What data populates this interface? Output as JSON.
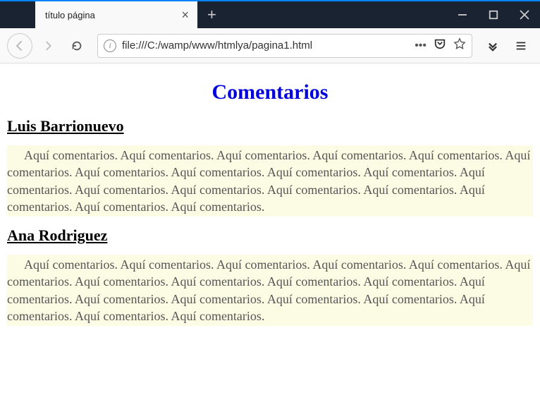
{
  "window": {
    "tab_title": "título página"
  },
  "toolbar": {
    "url": "file:///C:/wamp/www/htmlya/pagina1.html"
  },
  "page": {
    "heading": "Comentarios",
    "sections": [
      {
        "author": "Luis Barrionuevo",
        "comment": "Aquí comentarios. Aquí comentarios. Aquí comentarios. Aquí comentarios. Aquí comentarios. Aquí comentarios. Aquí comentarios. Aquí comentarios. Aquí comentarios. Aquí comentarios. Aquí comentarios. Aquí comentarios. Aquí comentarios. Aquí comentarios. Aquí comentarios. Aquí comentarios. Aquí comentarios. Aquí comentarios."
      },
      {
        "author": "Ana Rodriguez",
        "comment": "Aquí comentarios. Aquí comentarios. Aquí comentarios. Aquí comentarios. Aquí comentarios. Aquí comentarios. Aquí comentarios. Aquí comentarios. Aquí comentarios. Aquí comentarios. Aquí comentarios. Aquí comentarios. Aquí comentarios. Aquí comentarios. Aquí comentarios. Aquí comentarios. Aquí comentarios. Aquí comentarios."
      }
    ]
  }
}
